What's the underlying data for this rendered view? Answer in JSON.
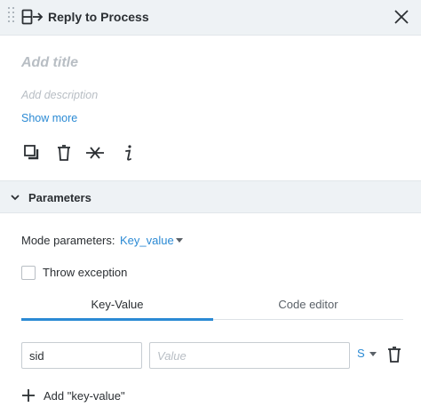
{
  "header": {
    "title": "Reply to Process",
    "icon": "reply-process-icon"
  },
  "form": {
    "title_placeholder": "Add title",
    "description_placeholder": "Add description",
    "show_more": "Show more"
  },
  "toolbar": [
    "copy-icon",
    "trash-icon",
    "disconnect-icon",
    "info-icon"
  ],
  "parameters": {
    "section_label": "Parameters",
    "mode_label": "Mode parameters:",
    "mode_value": "Key_value",
    "throw_exception_label": "Throw exception",
    "throw_exception_checked": false,
    "tabs": [
      {
        "label": "Key-Value",
        "active": true
      },
      {
        "label": "Code editor",
        "active": false
      }
    ],
    "rows": [
      {
        "key": "sid",
        "value": "",
        "value_placeholder": "Value",
        "type": "S"
      }
    ],
    "add_label": "Add \"key-value\""
  },
  "colors": {
    "accent": "#2b8ad4",
    "header_bg": "#eef2f5",
    "placeholder": "#b8bec4"
  }
}
